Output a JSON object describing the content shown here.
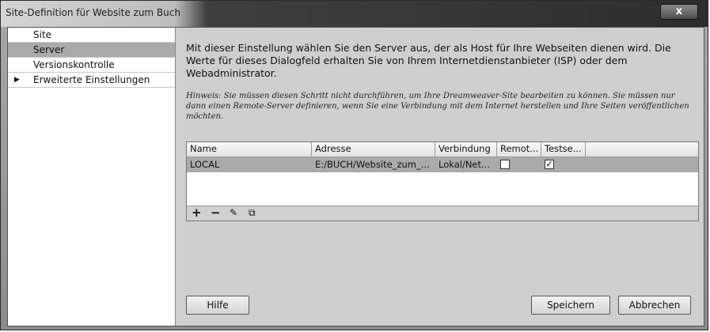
{
  "window": {
    "title": "Site-Definition für Website zum Buch",
    "close_glyph": "x"
  },
  "sidebar": {
    "items": [
      {
        "label": "Site"
      },
      {
        "label": "Server"
      },
      {
        "label": "Versionskontrolle"
      },
      {
        "label": "Erweiterte Einstellungen",
        "arrow": "▶"
      }
    ]
  },
  "content": {
    "description": "Mit dieser Einstellung wählen Sie den Server aus, der als Host für Ihre Webseiten dienen wird. Die Werte für dieses Dialogfeld erhalten Sie von Ihrem Internetdienstanbieter (ISP) oder dem Webadministrator.",
    "hint": "Hinweis: Sie müssen diesen Schritt nicht durchführen, um Ihre Dreamweaver-Site bearbeiten zu können. Sie müssen nur dann einen Remote-Server definieren, wenn Sie eine Verbindung mit dem Internet herstellen und Ihre Seiten veröffentlichen möchten."
  },
  "table": {
    "columns": [
      "Name",
      "Adresse",
      "Verbindung",
      "Remot...",
      "Testse..."
    ],
    "rows": [
      {
        "name": "LOCAL",
        "address": "E:/BUCH/Website_zum_...",
        "connection": "Lokal/Net...",
        "remote_checked": false,
        "testing_checked": true,
        "check_glyph": "✓"
      }
    ],
    "toolbar": {
      "add_glyph": "+",
      "remove_glyph": "−",
      "edit_glyph": "✎",
      "duplicate_glyph": "⧉"
    }
  },
  "buttons": {
    "help": "Hilfe",
    "save": "Speichern",
    "cancel": "Abbrechen"
  }
}
